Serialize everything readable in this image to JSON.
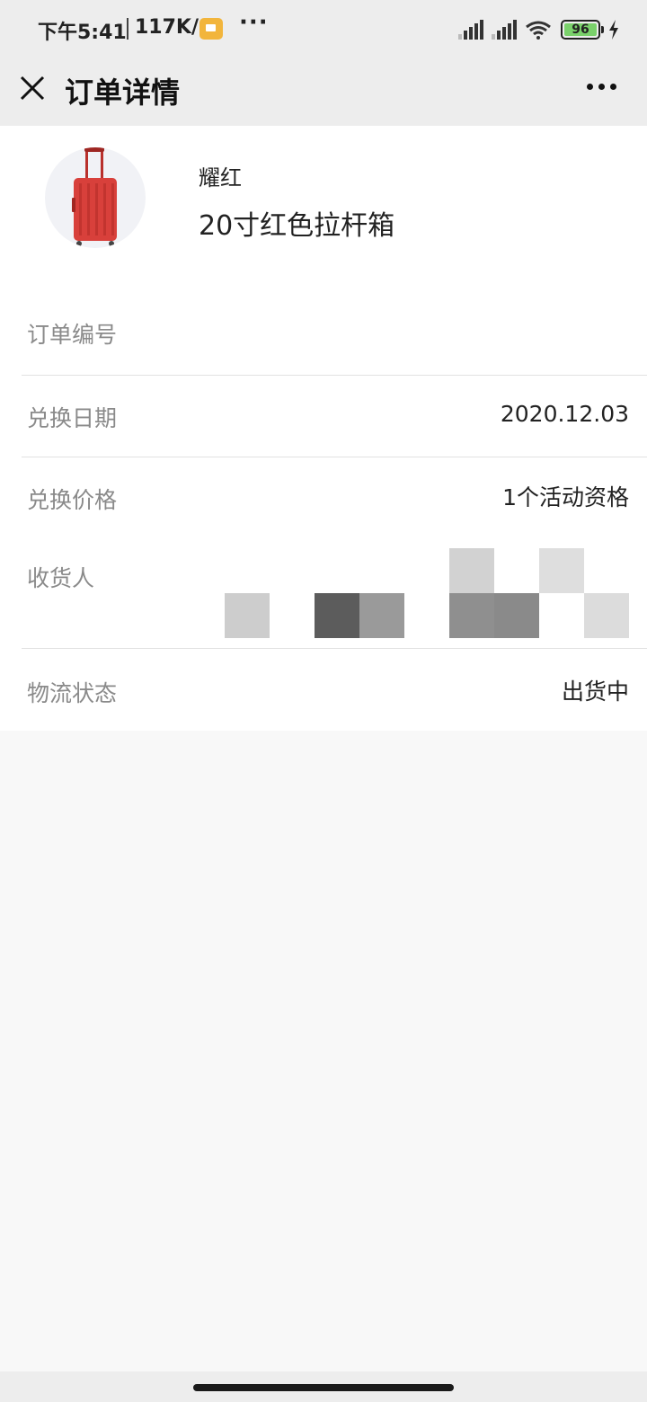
{
  "status_bar": {
    "time": "下午5:41",
    "speed": "117K/s",
    "overflow": "···",
    "battery_level": "96",
    "battery_color": "#7ad16b",
    "notification_color": "#f2b53c"
  },
  "header": {
    "title": "订单详情",
    "close_icon": "close-icon",
    "more_icon": "more-horizontal-icon",
    "background": "#ededed"
  },
  "product": {
    "brand": "耀红",
    "name": "20寸红色拉杆箱",
    "image": "red-suitcase",
    "accent_color": "#d8403b"
  },
  "details": {
    "order_number": {
      "label": "订单编号",
      "value": ""
    },
    "exchange_date": {
      "label": "兑换日期",
      "value": "2020.12.03"
    },
    "exchange_price": {
      "label": "兑换价格",
      "value": "1个活动资格"
    },
    "recipient": {
      "label": "收货人",
      "value_redacted": true
    },
    "logistics": {
      "label": "物流状态",
      "value": "出货中"
    }
  }
}
